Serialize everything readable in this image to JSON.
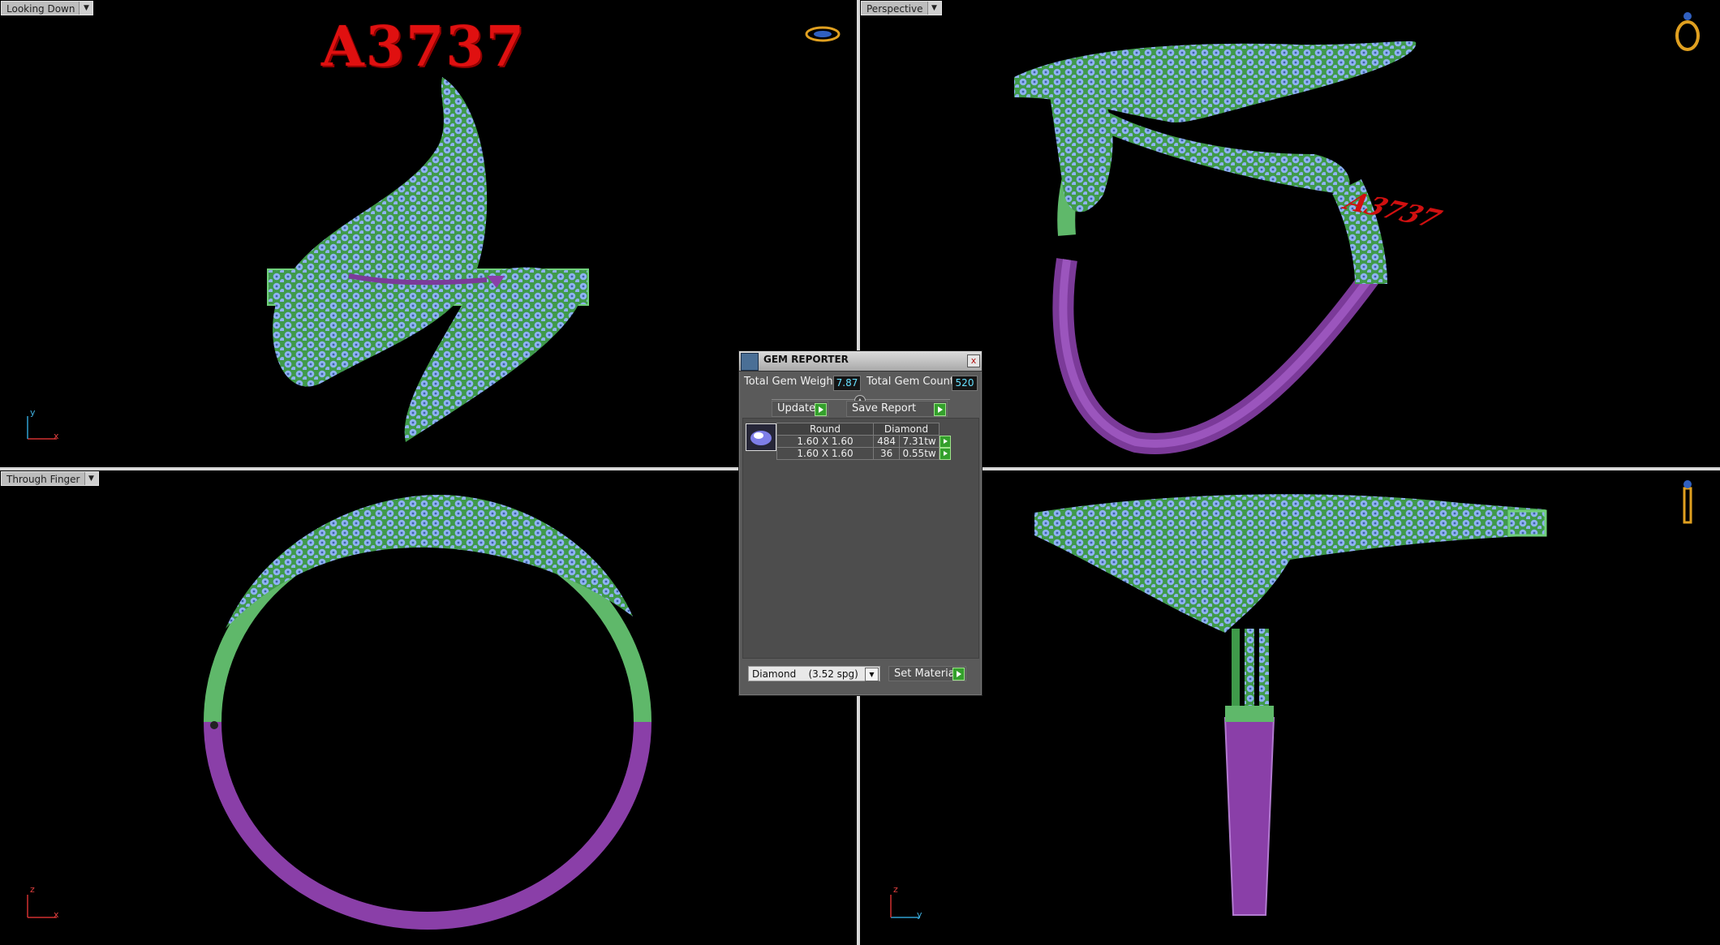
{
  "viewports": {
    "top_left": {
      "label": "Looking Down",
      "axis_v": "y",
      "axis_h": "x"
    },
    "top_right": {
      "label": "Perspective"
    },
    "bottom_left": {
      "label": "Through Finger",
      "axis_v": "z",
      "axis_h": "x"
    },
    "bottom_right": {
      "axis_v": "z",
      "axis_h": "y"
    }
  },
  "model": {
    "title": "A3737",
    "floating_title": "A3737"
  },
  "gem_reporter": {
    "title": "GEM REPORTER",
    "close_label": "x",
    "total_weight_label": "Total Gem Weight",
    "total_weight_value": "7.87",
    "total_count_label": "Total Gem Count",
    "total_count_value": "520",
    "update_label": "Update",
    "save_report_label": "Save Report",
    "table": {
      "headers": [
        "Round",
        "Diamond"
      ],
      "rows": [
        {
          "size": "1.60 X 1.60",
          "count": "484",
          "weight": "7.31tw"
        },
        {
          "size": "1.60 X 1.60",
          "count": "36",
          "weight": "0.55tw"
        }
      ]
    },
    "material_select": "Diamond    (3.52 spg)",
    "set_material_label": "Set Material"
  },
  "colors": {
    "metal_green": "#5fb86a",
    "metal_purple": "#8a3fa8",
    "gem_blue": "#8fb2f2",
    "title_red": "#e01010"
  },
  "icons": [
    "dropdown-arrow-icon",
    "ring-orientation-icon",
    "gem-icon",
    "play-icon",
    "close-icon",
    "collapse-icon"
  ]
}
